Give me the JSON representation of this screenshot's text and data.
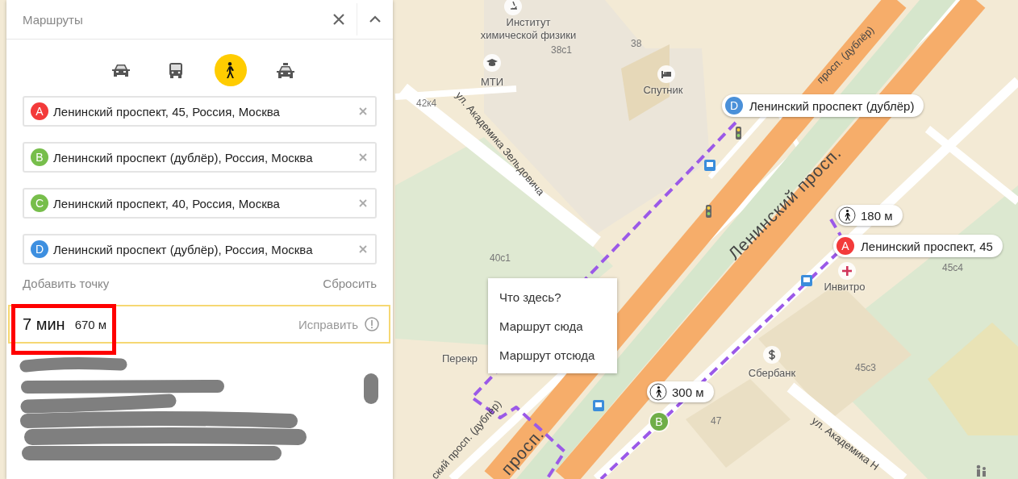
{
  "panel": {
    "title": "Маршруты",
    "modes": [
      {
        "kind": "car",
        "selected": false
      },
      {
        "kind": "bus",
        "selected": false
      },
      {
        "kind": "walk",
        "selected": true
      },
      {
        "kind": "taxi",
        "selected": false
      }
    ],
    "waypoints": [
      {
        "letter": "A",
        "color": "#f33a3a",
        "value": "Ленинский проспект, 45, Россия, Москва"
      },
      {
        "letter": "B",
        "color": "#77be4b",
        "value": "Ленинский проспект (дублёр), Россия, Москва"
      },
      {
        "letter": "C",
        "color": "#77be4b",
        "value": "Ленинский проспект, 40, Россия, Москва"
      },
      {
        "letter": "D",
        "color": "#3d8fe0",
        "value": "Ленинский проспект (дублёр), Россия, Москва"
      }
    ],
    "add_point": "Добавить точку",
    "reset": "Сбросить",
    "summary": {
      "time": "7 мин",
      "distance": "670 м",
      "fix": "Исправить",
      "highlighted": true
    }
  },
  "map": {
    "streets": [
      {
        "text": "ул. Академика Зельдовича",
        "kind": "street"
      },
      {
        "text": "просп. (дублёр)",
        "kind": "street"
      },
      {
        "text": "Ленинский просп.",
        "kind": "avenue"
      },
      {
        "text": "ский просп. (дублёр)",
        "kind": "street"
      },
      {
        "text": "просп.",
        "kind": "avenue"
      },
      {
        "text": "ул. Академика Н",
        "kind": "street"
      }
    ],
    "places": [
      {
        "text": "Институт химической физики",
        "kind": "science"
      },
      {
        "text": "МТИ",
        "kind": "education"
      },
      {
        "text": "Спутник",
        "kind": "hotel"
      },
      {
        "text": "Инвитро",
        "kind": "medical"
      },
      {
        "text": "Сбербанк",
        "kind": "bank"
      },
      {
        "text": "Перекр",
        "kind": "none"
      }
    ],
    "buildings": [
      "38с1",
      "38",
      "42к4",
      "40с1",
      "45с4",
      "45с3",
      "47"
    ],
    "markers": [
      {
        "letter": "D",
        "color": "#4a90d9",
        "label": "Ленинский проспект (дублёр)"
      },
      {
        "letter": "A",
        "color": "#f33a3a",
        "label": "Ленинский проспект, 45"
      },
      {
        "letter": "B",
        "color": "#6fae48"
      }
    ],
    "walk_badges": [
      {
        "distance": "180 м"
      },
      {
        "distance": "300 м"
      }
    ],
    "context_menu": [
      "Что здесь?",
      "Маршрут сюда",
      "Маршрут отсюда"
    ]
  }
}
